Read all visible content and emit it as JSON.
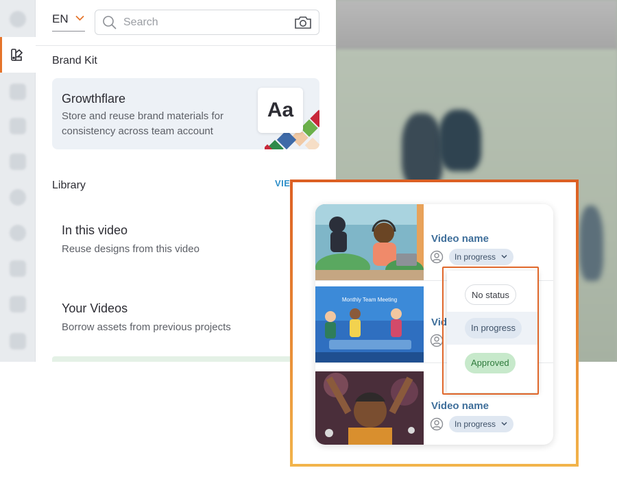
{
  "header": {
    "language": "EN",
    "search_placeholder": "Search"
  },
  "brand_kit": {
    "section_title": "Brand Kit",
    "card_name": "Growthflare",
    "card_description": "Store and reuse brand materials for consistency across team account",
    "tile_text": "Aa"
  },
  "library": {
    "section_title": "Library",
    "view_all_label": "VIEW ALL",
    "items": [
      {
        "title": "In this video",
        "description": "Reuse designs from this video"
      },
      {
        "title": "Your Videos",
        "description": "Borrow assets from previous projects"
      }
    ]
  },
  "videos": [
    {
      "name": "Video name",
      "status": "In progress"
    },
    {
      "name": "Vid",
      "status": ""
    },
    {
      "name": "Video name",
      "status": "In progress"
    }
  ],
  "thumbnail_2_text": "Monthly Team Meeting",
  "status_menu": {
    "options": [
      "No status",
      "In progress",
      "Approved"
    ],
    "highlighted": "In progress"
  },
  "colors": {
    "accent_orange": "#e5742b",
    "link_blue": "#2e8fc9",
    "video_name_blue": "#3e6e9a",
    "approved_green": "#2e7a3b"
  },
  "icons": [
    "brand-kit-icon",
    "chevron-down-icon",
    "search-icon",
    "camera-icon",
    "user-avatar-icon"
  ]
}
